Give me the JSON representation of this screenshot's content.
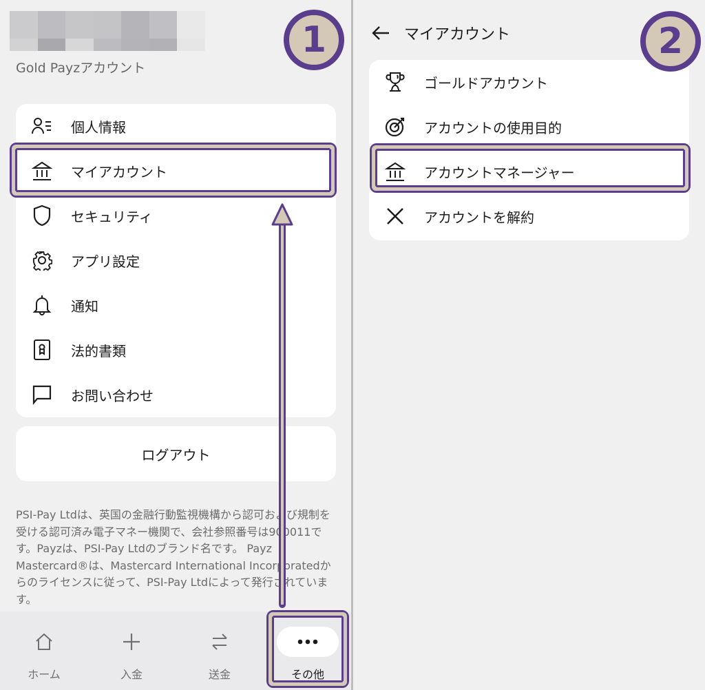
{
  "left_panel": {
    "account_type": "Gold Payzアカウント",
    "menu": [
      {
        "icon": "person-list-icon",
        "label": "個人情報"
      },
      {
        "icon": "bank-icon",
        "label": "マイアカウント"
      },
      {
        "icon": "shield-icon",
        "label": "セキュリティ"
      },
      {
        "icon": "gear-icon",
        "label": "アプリ設定"
      },
      {
        "icon": "bell-icon",
        "label": "通知"
      },
      {
        "icon": "certificate-icon",
        "label": "法的書類"
      },
      {
        "icon": "chat-bubble-icon",
        "label": "お問い合わせ"
      }
    ],
    "logout_label": "ログアウト",
    "disclaimer": "PSI-Pay Ltdは、英国の金融行動監視機構から認可および規制を受ける認可済み電子マネー機関で、会社参照番号は900011です。Payzは、PSI-Pay Ltdのブランド名です。 Payz Mastercard®は、Mastercard International Incorporatedからのライセンスに従って、PSI-Pay Ltdによって発行されています。",
    "bottom_nav": [
      {
        "icon": "home-icon",
        "label": "ホーム",
        "active": false
      },
      {
        "icon": "plus-icon",
        "label": "入金",
        "active": false
      },
      {
        "icon": "transfer-icon",
        "label": "送金",
        "active": false
      },
      {
        "icon": "more-dots-icon",
        "label": "その他",
        "active": true
      }
    ]
  },
  "right_panel": {
    "title": "マイアカウント",
    "menu": [
      {
        "icon": "trophy-icon",
        "label": "ゴールドアカウント"
      },
      {
        "icon": "target-icon",
        "label": "アカウントの使用目的"
      },
      {
        "icon": "bank-icon",
        "label": "アカウントマネージャー"
      },
      {
        "icon": "close-icon",
        "label": "アカウントを解約"
      }
    ]
  },
  "annotations": {
    "step1": "1",
    "step2": "2",
    "colors": {
      "outline": "#5a3d8c",
      "fill": "#d4c8b6"
    }
  }
}
